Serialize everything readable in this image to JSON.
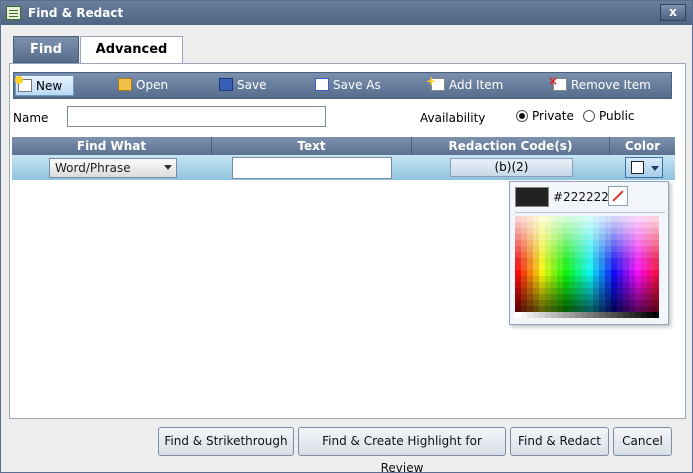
{
  "window": {
    "title": "Find & Redact",
    "close_label": "x"
  },
  "tabs": [
    {
      "label": "Find",
      "active": false
    },
    {
      "label": "Advanced",
      "active": true
    }
  ],
  "toolbar": {
    "new": "New",
    "open": "Open",
    "save": "Save",
    "save_as": "Save As",
    "add_item": "Add Item",
    "remove_item": "Remove Item"
  },
  "form": {
    "name_label": "Name",
    "name_value": "",
    "availability_label": "Availability",
    "options": [
      {
        "label": "Private",
        "selected": true
      },
      {
        "label": "Public",
        "selected": false
      }
    ]
  },
  "grid": {
    "columns": [
      "Find What",
      "Text",
      "Redaction Code(s)",
      "Color"
    ],
    "rows": [
      {
        "find_what": "Word/Phrase",
        "text": "",
        "code": "(b)(2)",
        "color": "#ffffff"
      }
    ]
  },
  "color_picker": {
    "current_hex": "#222222",
    "current_color": "#222222"
  },
  "buttons": {
    "strikethrough": "Find & Strikethrough",
    "highlight": "Find & Create Highlight for Review",
    "redact": "Find & Redact",
    "cancel": "Cancel"
  }
}
